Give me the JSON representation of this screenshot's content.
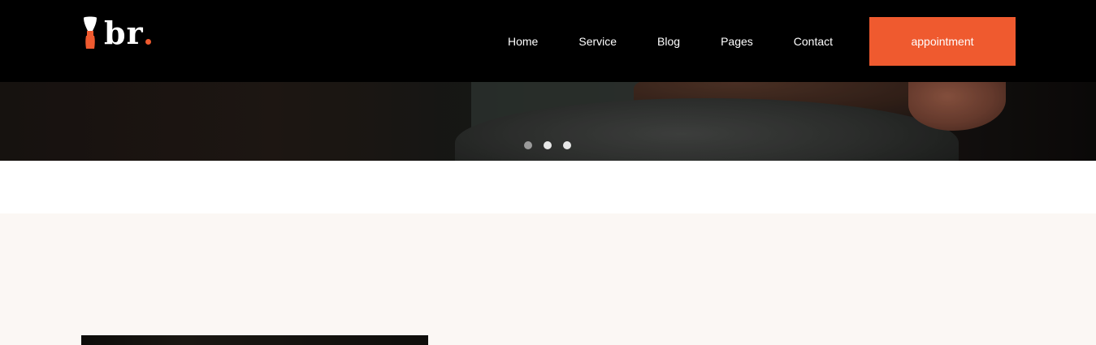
{
  "brand": {
    "logo_text": "br",
    "accent_color": "#ef5a2f",
    "icon": "shaving-brush-icon"
  },
  "nav": {
    "items": [
      {
        "label": "Home"
      },
      {
        "label": "Service"
      },
      {
        "label": "Blog"
      },
      {
        "label": "Pages"
      },
      {
        "label": "Contact"
      }
    ],
    "cta_label": "appointment"
  },
  "hero": {
    "slides_count": 3,
    "active_slide": 2
  },
  "colors": {
    "header_bg": "#000000",
    "section_bg": "#fbf7f4",
    "cta_bg": "#ef5a2f"
  }
}
